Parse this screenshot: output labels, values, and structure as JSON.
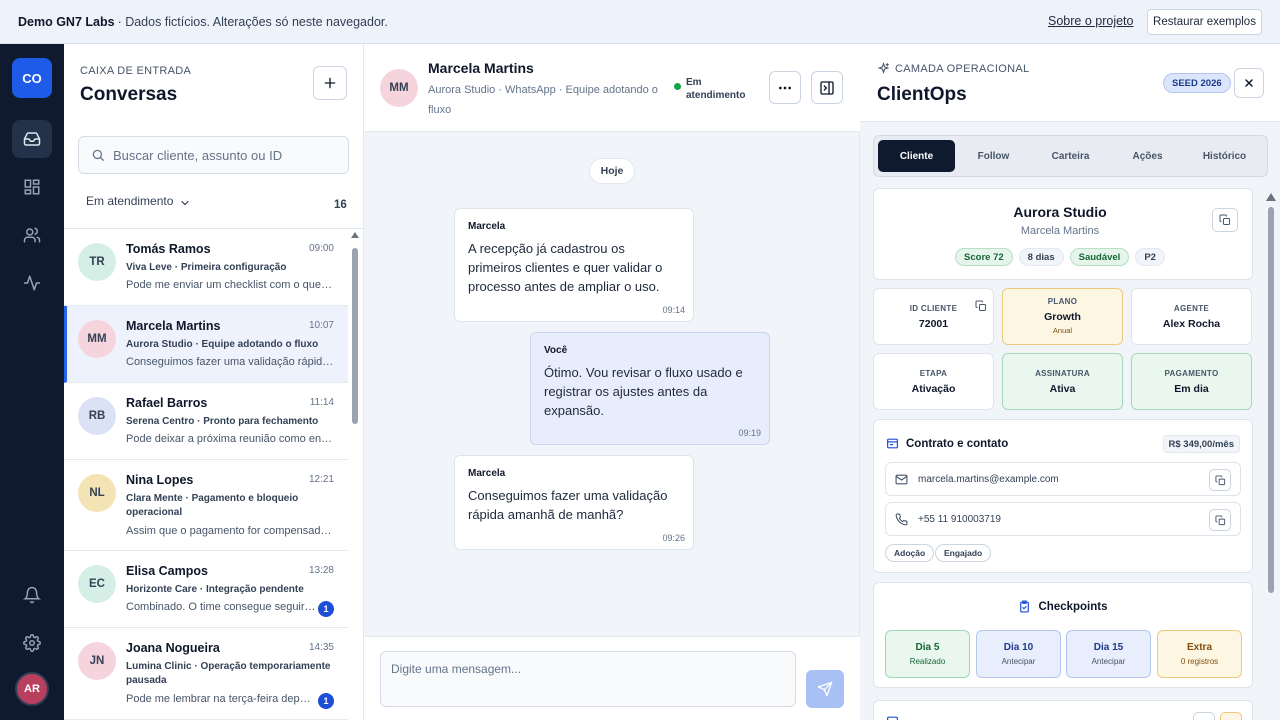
{
  "topbar": {
    "brand": "Demo GN7 Labs",
    "subtitle": "· Dados fictícios. Alterações só neste navegador.",
    "about_link": "Sobre o projeto",
    "restore_button": "Restaurar exemplos"
  },
  "rail": {
    "logo": "CO",
    "items": [
      {
        "icon": "inbox-icon",
        "active": true
      },
      {
        "icon": "grid-icon",
        "active": false
      },
      {
        "icon": "users-icon",
        "active": false
      },
      {
        "icon": "activity-icon",
        "active": false
      }
    ],
    "bottom": [
      {
        "icon": "bell-icon"
      },
      {
        "icon": "gear-icon"
      }
    ],
    "avatar": "AR"
  },
  "inbox": {
    "eyebrow": "CAIXA DE ENTRADA",
    "title": "Conversas",
    "search_placeholder": "Buscar cliente, assunto ou ID",
    "filter_label": "Em atendimento",
    "count": "16",
    "conversations": [
      {
        "initials": "TR",
        "avatar_color": "#d5efe6",
        "name": "Tomás Ramos",
        "time": "09:00",
        "subject": "Viva Leve · Primeira configuração",
        "preview": "Pode me enviar um checklist com o que precisa?",
        "unread": "",
        "active": false
      },
      {
        "initials": "MM",
        "avatar_color": "#f6d4dd",
        "name": "Marcela Martins",
        "time": "10:07",
        "subject": "Aurora Studio · Equipe adotando o fluxo",
        "preview": "Conseguimos fazer uma validação rápida amanhã de manhã?",
        "unread": "",
        "active": true
      },
      {
        "initials": "RB",
        "avatar_color": "#dbe2f6",
        "name": "Rafael Barros",
        "time": "11:14",
        "subject": "Serena Centro · Pronto para fechamento",
        "preview": "Pode deixar a próxima reunião como encaminhada?",
        "unread": "",
        "active": false
      },
      {
        "initials": "NL",
        "avatar_color": "#f4e3b4",
        "name": "Nina Lopes",
        "time": "12:21",
        "subject": "Clara Mente · Pagamento e bloqueio operacional",
        "preview": "Assim que o pagamento for compensado, liberamos o acesso.",
        "unread": "",
        "active": false
      },
      {
        "initials": "EC",
        "avatar_color": "#d5efe6",
        "name": "Elisa Campos",
        "time": "13:28",
        "subject": "Horizonte Care · Integração pendente",
        "preview": "Combinado. O time consegue seguir por aqui.",
        "unread": "1",
        "active": false
      },
      {
        "initials": "JN",
        "avatar_color": "#f6d4dd",
        "name": "Joana Nogueira",
        "time": "14:35",
        "subject": "Lumina Clinic · Operação temporariamente pausada",
        "preview": "Pode me lembrar na terça-feira depois do almoço?",
        "unread": "1",
        "active": false
      }
    ]
  },
  "chat": {
    "initials": "MM",
    "name": "Marcela Martins",
    "subtitle": "Aurora Studio · WhatsApp · Equipe adotando o fluxo",
    "status": "Em atendimento",
    "day_label": "Hoje",
    "messages": [
      {
        "author": "Marcela",
        "text": "A recepção já cadastrou os primeiros clientes e quer validar o processo antes de ampliar o uso.",
        "time": "09:14",
        "mine": false
      },
      {
        "author": "Você",
        "text": "Ótimo. Vou revisar o fluxo usado e registrar os ajustes antes da expansão.",
        "time": "09:19",
        "mine": true
      },
      {
        "author": "Marcela",
        "text": "Conseguimos fazer uma validação rápida amanhã de manhã?",
        "time": "09:26",
        "mine": false
      }
    ],
    "compose_placeholder": "Digite uma mensagem..."
  },
  "panel": {
    "eyebrow": "CAMADA OPERACIONAL",
    "title": "ClientOps",
    "seed_badge": "SEED 2026",
    "tabs": [
      "Cliente",
      "Follow",
      "Carteira",
      "Ações",
      "Histórico"
    ],
    "active_tab": "Cliente",
    "client": {
      "company": "Aurora Studio",
      "contact": "Marcela Martins",
      "pills": [
        "Score 72",
        "8 dias",
        "Saudável",
        "P2"
      ]
    },
    "stats": [
      {
        "key": "ID CLIENTE",
        "value": "72001",
        "sub": ""
      },
      {
        "key": "PLANO",
        "value": "Growth",
        "sub": "Anual"
      },
      {
        "key": "AGENTE",
        "value": "Alex Rocha",
        "sub": ""
      },
      {
        "key": "ETAPA",
        "value": "Ativação",
        "sub": ""
      },
      {
        "key": "ASSINATURA",
        "value": "Ativa",
        "sub": ""
      },
      {
        "key": "PAGAMENTO",
        "value": "Em dia",
        "sub": ""
      }
    ],
    "contract": {
      "title": "Contrato e contato",
      "price": "R$ 349,00/mês",
      "email": "marcela.martins@example.com",
      "phone": "+55 11 910003719",
      "tags": [
        "Adoção",
        "Engajado"
      ]
    },
    "checkpoints": {
      "title": "Checkpoints",
      "items": [
        {
          "label": "Dia 5",
          "sub": "Realizado",
          "color": "#16a34a"
        },
        {
          "label": "Dia 10",
          "sub": "Antecipar",
          "color": "#2563eb"
        },
        {
          "label": "Dia 15",
          "sub": "Antecipar",
          "color": "#2563eb"
        },
        {
          "label": "Extra",
          "sub": "0 registros",
          "color": "#ca8a04"
        }
      ]
    }
  },
  "colors": {
    "accent": "#1d5be8",
    "rail": "#0f1a2e",
    "success": "#16a34a",
    "unread": "#1d4ed8"
  }
}
